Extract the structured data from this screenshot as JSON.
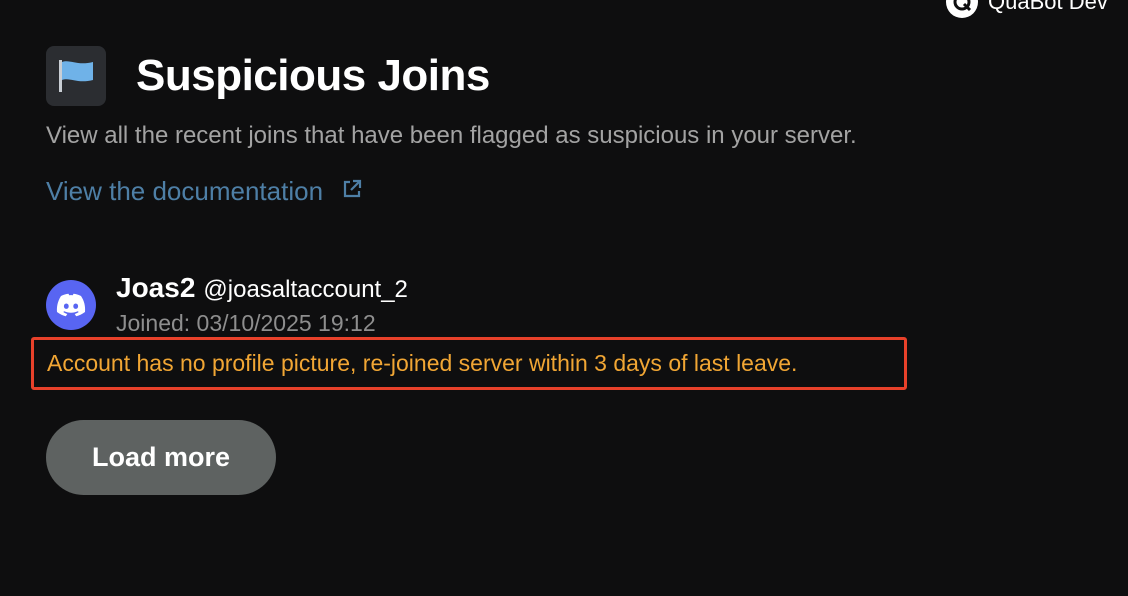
{
  "topbar": {
    "bot_name": "QuaBot Dev",
    "logo_icon": "quabot-logo-icon"
  },
  "header": {
    "icon": "flag-icon",
    "title": "Suspicious Joins",
    "subtitle": "View all the recent joins that have been flagged as suspicious in your server.",
    "doc_link": "View the documentation",
    "doc_link_icon": "external-link-icon"
  },
  "entries": [
    {
      "avatar_icon": "discord-icon",
      "username": "Joas2",
      "handle": "@joasaltaccount_2",
      "joined": "Joined: 03/10/2025 19:12",
      "reason": "Account has no profile picture, re-joined server within 3 days of last leave."
    }
  ],
  "actions": {
    "load_more": "Load more"
  },
  "colors": {
    "background": "#0e0e0f",
    "link": "#4e7fa6",
    "warning_text": "#f1a634",
    "highlight_border": "#e8412a",
    "button_bg": "#5e6261",
    "discord_blurple": "#5865f2"
  }
}
